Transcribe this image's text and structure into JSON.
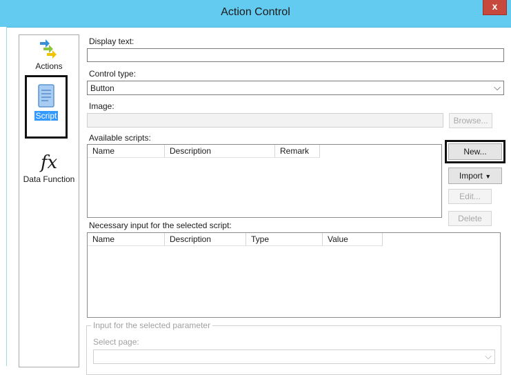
{
  "window": {
    "title": "Action Control",
    "close_glyph": "x"
  },
  "nav": {
    "items": [
      {
        "label": "Actions",
        "icon": "arrows-icon"
      },
      {
        "label": "Script",
        "icon": "script-document-icon"
      },
      {
        "label": "Data Function",
        "icon": "function-fx-icon"
      }
    ],
    "fx_glyph": "fx"
  },
  "form": {
    "display_text_label": "Display text:",
    "display_text_value": "",
    "control_type_label": "Control type:",
    "control_type_value": "Button",
    "image_label": "Image:",
    "image_value": "",
    "browse_label": "Browse...",
    "available_scripts_label": "Available scripts:",
    "scripts_columns": [
      "Name",
      "Description",
      "Remark"
    ],
    "new_label": "New...",
    "import_label": "Import",
    "edit_label": "Edit...",
    "delete_label": "Delete",
    "necessary_input_label": "Necessary input for the selected script:",
    "input_columns": [
      "Name",
      "Description",
      "Type",
      "Value"
    ],
    "param_group_label": "Input for the selected parameter",
    "select_page_label": "Select page:",
    "select_page_value": ""
  },
  "colors": {
    "titlebar": "#63cbef",
    "close": "#c7483c",
    "selection": "#3399ff"
  }
}
